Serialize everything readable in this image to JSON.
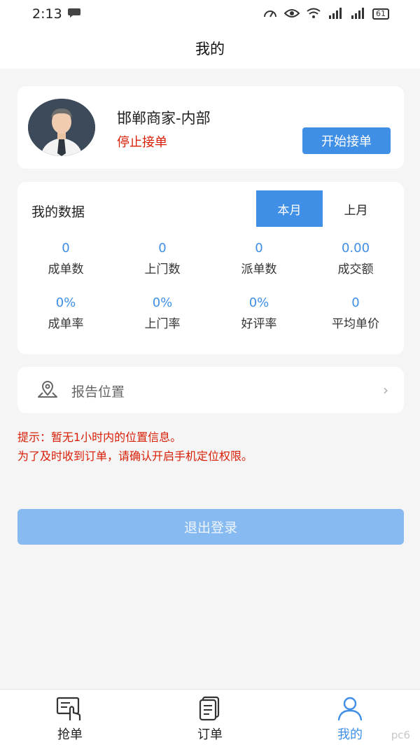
{
  "status_bar": {
    "time": "2:13",
    "battery": "61"
  },
  "header": {
    "title": "我的"
  },
  "profile": {
    "name": "邯郸商家-内部",
    "status": "停止接单",
    "start_button": "开始接单"
  },
  "data_card": {
    "title": "我的数据",
    "tabs": [
      {
        "label": "本月",
        "active": true
      },
      {
        "label": "上月",
        "active": false
      }
    ],
    "stats": [
      {
        "value": "0",
        "label": "成单数"
      },
      {
        "value": "0",
        "label": "上门数"
      },
      {
        "value": "0",
        "label": "派单数"
      },
      {
        "value": "0.00",
        "label": "成交额"
      },
      {
        "value": "0%",
        "label": "成单率"
      },
      {
        "value": "0%",
        "label": "上门率"
      },
      {
        "value": "0%",
        "label": "好评率"
      },
      {
        "value": "0",
        "label": "平均单价"
      }
    ]
  },
  "location": {
    "label": "报告位置",
    "arrow": "›"
  },
  "tips": [
    "提示：暂无1小时内的位置信息。",
    "为了及时收到订单，请确认开启手机定位权限。"
  ],
  "logout_button": "退出登录",
  "nav": {
    "items": [
      {
        "label": "抢单",
        "icon": "grab-order-icon",
        "active": false
      },
      {
        "label": "订单",
        "icon": "order-icon",
        "active": false
      },
      {
        "label": "我的",
        "icon": "profile-icon",
        "active": true
      }
    ]
  },
  "colors": {
    "accent": "#3f8fe6",
    "alert": "#d81e06",
    "logout": "#86baf1"
  },
  "watermark": "pc6"
}
